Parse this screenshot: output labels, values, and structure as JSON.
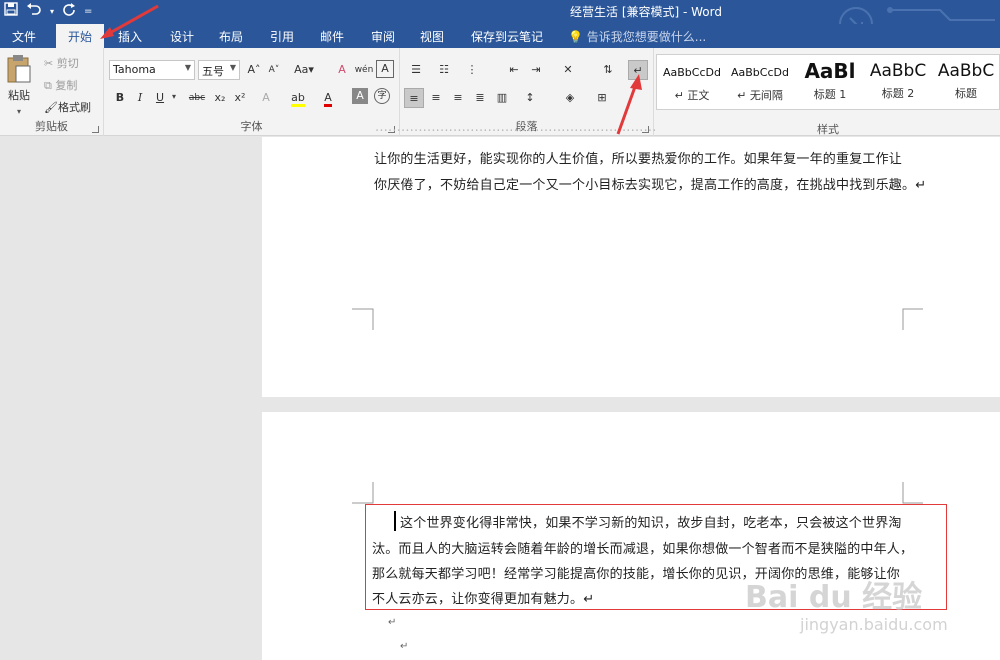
{
  "window": {
    "title": "经营生活 [兼容模式] - Word"
  },
  "qat": {
    "save_icon": "save-icon",
    "undo_icon": "undo-icon",
    "redo_icon": "redo-icon",
    "customize": "="
  },
  "tabs": [
    "文件",
    "开始",
    "插入",
    "设计",
    "布局",
    "引用",
    "邮件",
    "审阅",
    "视图",
    "保存到云笔记"
  ],
  "tell_me": "告诉我您想要做什么...",
  "clipboard": {
    "paste": "粘贴",
    "cut": "剪切",
    "copy": "复制",
    "format_painter": "格式刷",
    "label": "剪贴板"
  },
  "font": {
    "name": "Tahoma",
    "size": "五号",
    "grow": "A",
    "shrink": "A",
    "case": "Aa",
    "clear": "A",
    "wen": "wén",
    "border": "A",
    "bold": "B",
    "italic": "I",
    "underline": "U",
    "strike": "abc",
    "sub": "x₂",
    "sup": "x²",
    "effects": "A",
    "highlight": "ab",
    "color": "A",
    "shade": "A",
    "circle": "字",
    "label": "字体"
  },
  "paragraph": {
    "label": "段落"
  },
  "styles": {
    "label": "样式",
    "items": [
      {
        "sample": "AaBbCcDd",
        "name": "↵ 正文"
      },
      {
        "sample": "AaBbCcDd",
        "name": "↵ 无间隔"
      },
      {
        "sample": "AaBl",
        "name": "标题 1"
      },
      {
        "sample": "AaBbC",
        "name": "标题 2"
      },
      {
        "sample": "AaBbC",
        "name": "标题"
      }
    ]
  },
  "document": {
    "page1_lines": [
      "让你的生活更好，能实现你的人生价值，所以要热爱你的工作。如果年复一年的重复工作让",
      "你厌倦了，不妨给自己定一个又一个小目标去实现它，提高工作的高度，在挑战中找到乐趣。↵"
    ],
    "page2_lines": [
      "这个世界变化得非常快，如果不学习新的知识，故步自封，吃老本，只会被这个世界淘",
      "汰。而且人的大脑运转会随着年龄的增长而减退，如果你想做一个智者而不是狭隘的中年人，",
      "那么就每天都学习吧！经常学习能提高你的技能，增长你的见识，开阔你的思维，能够让你",
      "不人云亦云，让你变得更加有魅力。↵"
    ],
    "empty_marks": [
      "↵",
      "↵"
    ]
  },
  "watermark": {
    "brand": "Bai du 经验",
    "url": "jingyan.baidu.com"
  },
  "colors": {
    "title_bar": "#2b579a",
    "annotation": "#e23a3a"
  }
}
